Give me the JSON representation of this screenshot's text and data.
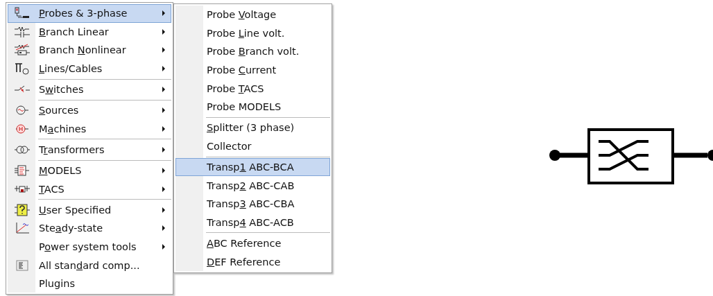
{
  "main_menu": {
    "items": [
      {
        "kind": "item",
        "label": {
          "key": "P",
          "post": "robes & 3-phase"
        },
        "submenu": true,
        "selected": true
      },
      {
        "kind": "item",
        "label": {
          "key": "B",
          "post": "ranch Linear"
        },
        "submenu": true,
        "selected": false
      },
      {
        "kind": "item",
        "label": {
          "pre": "Branch ",
          "key": "N",
          "post": "onlinear"
        },
        "submenu": true,
        "selected": false
      },
      {
        "kind": "item",
        "label": {
          "key": "L",
          "post": "ines/Cables"
        },
        "submenu": true,
        "selected": false
      },
      {
        "kind": "separator"
      },
      {
        "kind": "item",
        "label": {
          "pre": "S",
          "key": "w",
          "post": "itches"
        },
        "submenu": true,
        "selected": false
      },
      {
        "kind": "separator"
      },
      {
        "kind": "item",
        "label": {
          "key": "S",
          "post": "ources"
        },
        "submenu": true,
        "selected": false
      },
      {
        "kind": "item",
        "label": {
          "pre": "M",
          "key": "a",
          "post": "chines"
        },
        "submenu": true,
        "selected": false
      },
      {
        "kind": "separator"
      },
      {
        "kind": "item",
        "label": {
          "pre": "T",
          "key": "r",
          "post": "ansformers"
        },
        "submenu": true,
        "selected": false
      },
      {
        "kind": "separator"
      },
      {
        "kind": "item",
        "label": {
          "key": "M",
          "post": "ODELS"
        },
        "submenu": true,
        "selected": false
      },
      {
        "kind": "item",
        "label": {
          "key": "T",
          "post": "ACS"
        },
        "submenu": true,
        "selected": false
      },
      {
        "kind": "separator"
      },
      {
        "kind": "item",
        "label": {
          "key": "U",
          "post": "ser Specified"
        },
        "submenu": true,
        "selected": false
      },
      {
        "kind": "item",
        "label": {
          "pre": "Ste",
          "key": "a",
          "post": "dy-state"
        },
        "submenu": true,
        "selected": false
      },
      {
        "kind": "item",
        "label": {
          "pre": "P",
          "key": "o",
          "post": "wer system tools"
        },
        "submenu": true,
        "selected": false
      },
      {
        "kind": "item",
        "label": {
          "pre": "All stan",
          "key": "d",
          "post": "ard comp..."
        },
        "submenu": false,
        "selected": false
      },
      {
        "kind": "item",
        "label": {
          "text": "Plugins"
        },
        "submenu": false,
        "selected": false
      }
    ]
  },
  "sub_menu": {
    "items": [
      {
        "kind": "item",
        "label": {
          "pre": "Probe ",
          "key": "V",
          "post": "oltage"
        },
        "selected": false
      },
      {
        "kind": "item",
        "label": {
          "pre": "Probe ",
          "key": "L",
          "post": "ine volt."
        },
        "selected": false
      },
      {
        "kind": "item",
        "label": {
          "pre": "Probe ",
          "key": "B",
          "post": "ranch volt."
        },
        "selected": false
      },
      {
        "kind": "item",
        "label": {
          "pre": "Probe ",
          "key": "C",
          "post": "urrent"
        },
        "selected": false
      },
      {
        "kind": "item",
        "label": {
          "pre": "Probe ",
          "key": "T",
          "post": "ACS"
        },
        "selected": false
      },
      {
        "kind": "item",
        "label": {
          "text": "Probe MODELS"
        },
        "selected": false
      },
      {
        "kind": "separator"
      },
      {
        "kind": "item",
        "label": {
          "key": "S",
          "post": "plitter (3 phase)"
        },
        "selected": false
      },
      {
        "kind": "item",
        "label": {
          "text": "Collector"
        },
        "selected": false
      },
      {
        "kind": "separator"
      },
      {
        "kind": "item",
        "label": {
          "pre": "Transp",
          "key": "1",
          "post": " ABC-BCA"
        },
        "selected": true
      },
      {
        "kind": "item",
        "label": {
          "pre": "Transp",
          "key": "2",
          "post": " ABC-CAB"
        },
        "selected": false
      },
      {
        "kind": "item",
        "label": {
          "pre": "Transp",
          "key": "3",
          "post": " ABC-CBA"
        },
        "selected": false
      },
      {
        "kind": "item",
        "label": {
          "pre": "Transp",
          "key": "4",
          "post": " ABC-ACB"
        },
        "selected": false
      },
      {
        "kind": "separator"
      },
      {
        "kind": "item",
        "label": {
          "key": "A",
          "post": "BC Reference"
        },
        "selected": false
      },
      {
        "kind": "item",
        "label": {
          "key": "D",
          "post": "EF Reference"
        },
        "selected": false
      }
    ]
  }
}
